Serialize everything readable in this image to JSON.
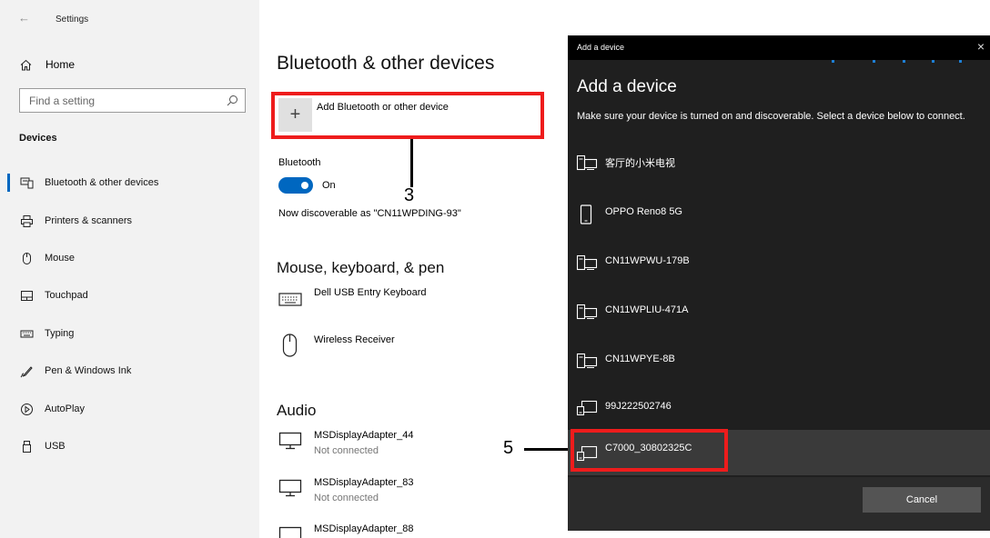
{
  "window": {
    "title": "Settings",
    "back_glyph": "←"
  },
  "sidebar": {
    "home_label": "Home",
    "search_placeholder": "Find a setting",
    "section_title": "Devices",
    "items": [
      {
        "label": "Bluetooth & other devices",
        "icon": "bluetooth-devices-icon",
        "active": true
      },
      {
        "label": "Printers & scanners",
        "icon": "printer-icon"
      },
      {
        "label": "Mouse",
        "icon": "mouse-icon"
      },
      {
        "label": "Touchpad",
        "icon": "touchpad-icon"
      },
      {
        "label": "Typing",
        "icon": "keyboard-icon"
      },
      {
        "label": "Pen & Windows Ink",
        "icon": "pen-icon"
      },
      {
        "label": "AutoPlay",
        "icon": "autoplay-icon"
      },
      {
        "label": "USB",
        "icon": "usb-icon"
      }
    ]
  },
  "main": {
    "title": "Bluetooth & other devices",
    "add_device_label": "Add Bluetooth or other device",
    "add_glyph": "+",
    "bluetooth_label": "Bluetooth",
    "toggle_state": "On",
    "discoverable_text": "Now discoverable as \"CN11WPDING-93\"",
    "mkp_heading": "Mouse, keyboard, & pen",
    "mkp_devices": [
      {
        "name": "Dell USB Entry Keyboard",
        "icon": "keyboard-icon"
      },
      {
        "name": "Wireless Receiver",
        "icon": "mouse-icon"
      }
    ],
    "audio_heading": "Audio",
    "audio_devices": [
      {
        "name": "MSDisplayAdapter_44",
        "status": "Not connected",
        "icon": "display-icon"
      },
      {
        "name": "MSDisplayAdapter_83",
        "status": "Not connected",
        "icon": "display-icon"
      },
      {
        "name": "MSDisplayAdapter_88",
        "status": "",
        "icon": "display-icon"
      }
    ]
  },
  "annotations": {
    "callout_add_number": "3",
    "callout_device_number": "5",
    "highlight_color": "#ee1c1c"
  },
  "dialog": {
    "titlebar": "Add a device",
    "close_glyph": "×",
    "heading": "Add a device",
    "description": "Make sure your device is turned on and discoverable. Select a device below to connect.",
    "devices": [
      {
        "name": "客厅的小米电视",
        "icon": "computer-device-icon"
      },
      {
        "name": "OPPO Reno8 5G",
        "icon": "phone-icon"
      },
      {
        "name": "CN11WPWU-179B",
        "icon": "computer-device-icon"
      },
      {
        "name": "CN11WPLIU-471A",
        "icon": "computer-device-icon"
      },
      {
        "name": "CN11WPYE-8B",
        "icon": "computer-device-icon"
      },
      {
        "name": "99J222502746",
        "icon": "display-device-icon"
      },
      {
        "name": "C7000_30802325C",
        "icon": "display-device-icon",
        "selected": true
      }
    ],
    "cancel_label": "Cancel"
  },
  "colors": {
    "accent": "#0067c0",
    "dialog_bg": "#1f1f1f"
  }
}
